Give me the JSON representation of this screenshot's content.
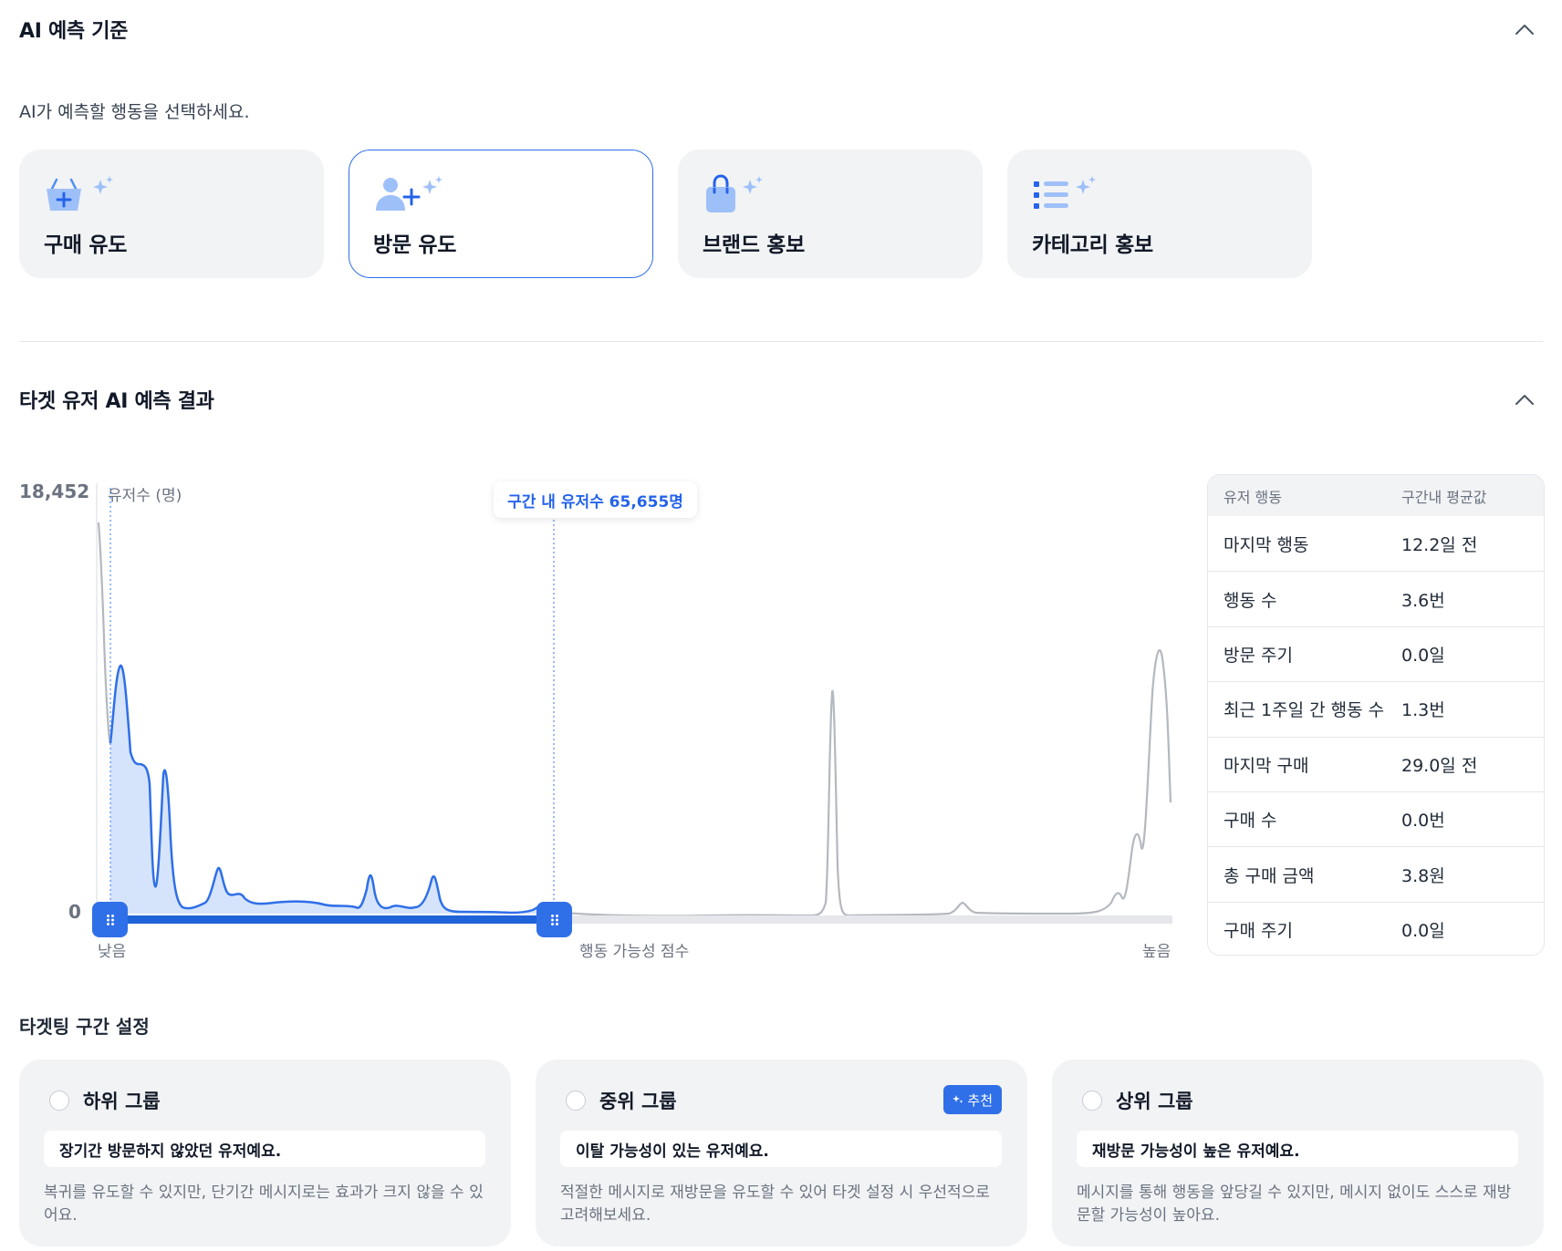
{
  "criteria": {
    "title": "AI 예측 기준",
    "subtitle": "AI가 예측할 행동을 선택하세요.",
    "options": [
      {
        "label": "구매 유도",
        "icon": "basket-plus-sparkle-icon",
        "selected": false
      },
      {
        "label": "방문 유도",
        "icon": "user-plus-sparkle-icon",
        "selected": true
      },
      {
        "label": "브랜드 홍보",
        "icon": "shopping-bag-sparkle-icon",
        "selected": false
      },
      {
        "label": "카테고리 홍보",
        "icon": "list-sparkle-icon",
        "selected": false
      }
    ]
  },
  "results": {
    "title": "타겟 유저 AI 예측 결과",
    "chart": {
      "y_max_label": "18,452",
      "y_zero_label": "0",
      "y_unit": "유저수 (명)",
      "x_low": "낮음",
      "x_mid": "행동 가능성 점수",
      "x_high": "높음",
      "tooltip": "구간 내 유저수 65,655명"
    },
    "stats": {
      "header": [
        "유저 행동",
        "구간내 평균값"
      ],
      "rows": [
        [
          "마지막 행동",
          "12.2일 전"
        ],
        [
          "행동 수",
          "3.6번"
        ],
        [
          "방문 주기",
          "0.0일"
        ],
        [
          "최근 1주일 간 행동 수",
          "1.3번"
        ],
        [
          "마지막 구매",
          "29.0일 전"
        ],
        [
          "구매 수",
          "0.0번"
        ],
        [
          "총 구매 금액",
          "3.8원"
        ],
        [
          "구매 주기",
          "0.0일"
        ]
      ]
    }
  },
  "chart_data": {
    "type": "area",
    "y_unit": "유저수 (명)",
    "xlabel": "행동 가능성 점수",
    "ylim": [
      0,
      18452
    ],
    "x_range_labels": [
      "낮음",
      "높음"
    ],
    "selected_range": [
      0,
      0.42
    ],
    "selected_count": "65,655",
    "colors": {
      "selected": "#2f6fe8",
      "selected_fill": "#d6e4fb",
      "unselected": "#b4b8bf"
    }
  },
  "targeting": {
    "title": "타겟팅 구간 설정",
    "groups": [
      {
        "name": "하위 그룹",
        "summary": "장기간 방문하지 않았던 유저예요.",
        "desc": "복귀를 유도할 수 있지만, 단기간 메시지로는 효과가 크지 않을 수 있어요.",
        "badge": ""
      },
      {
        "name": "중위 그룹",
        "summary": "이탈 가능성이 있는 유저예요.",
        "desc": "적절한 메시지로 재방문을 유도할 수 있어 타겟 설정 시 우선적으로 고려해보세요.",
        "badge": "추천"
      },
      {
        "name": "상위 그룹",
        "summary": "재방문 가능성이 높은 유저예요.",
        "desc": "메시지를 통해 행동을 앞당길 수 있지만, 메시지 없이도 스스로 재방문할 가능성이 높아요.",
        "badge": ""
      }
    ]
  }
}
